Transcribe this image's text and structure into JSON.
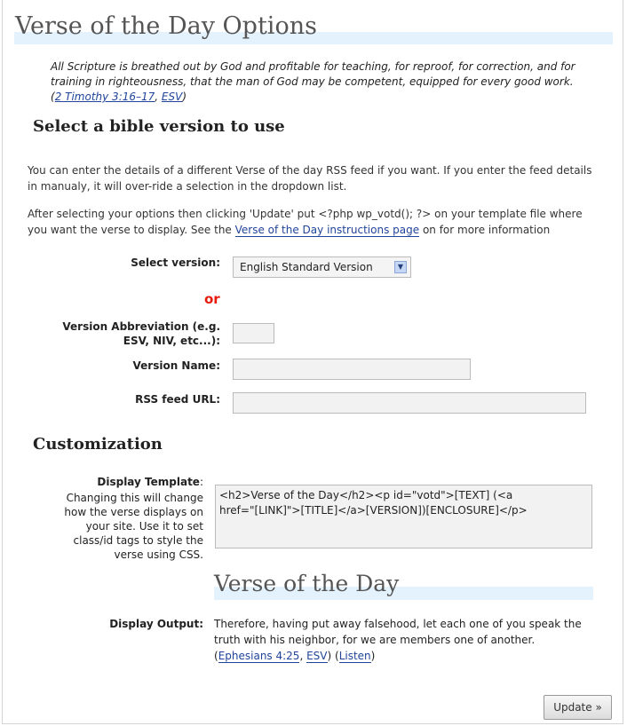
{
  "page": {
    "title": "Verse of the Day Options"
  },
  "quote": {
    "text": "All Scripture is breathed out by God and profitable for teaching, for reproof, for correction, and for training in righteousness, that the man of God may be competent, equipped for every good work.",
    "ref_open": " (",
    "ref_link": "2 Timothy 3:16–17",
    "ref_sep": ", ",
    "ref_version": "ESV",
    "ref_close": ")"
  },
  "section_version": {
    "heading": "Select a bible version to use",
    "para1": "You can enter the details of a different Verse of the day RSS feed if you want. If you enter the feed details in manualy, it will over-ride a selection in the dropdown list.",
    "para2_before": "After selecting your options then clicking 'Update' put <?php wp_votd(); ?> on your template file where you want the verse to display. See the ",
    "para2_link": "Verse of the Day instructions page",
    "para2_after": " on for more information"
  },
  "form": {
    "select_label": "Select version:",
    "select_value": "English Standard Version",
    "or_text": "or",
    "abbr_label_line1": "Version Abbreviation (e.g.",
    "abbr_label_line2": "ESV, NIV, etc...):",
    "abbr_value": "",
    "name_label": "Version Name:",
    "name_value": "",
    "rss_label": "RSS feed URL:",
    "rss_value": ""
  },
  "section_custom": {
    "heading": "Customization",
    "template_label": "Display Template",
    "template_colon": ":",
    "template_help": "Changing this will change how the verse displays on your site. Use it to set class/id tags to style the verse using CSS.",
    "template_value_line1": "<h2>Verse of the Day</h2><p id=\"votd\">[TEXT] (<a",
    "template_value_line2": "href=\"[LINK]\">[TITLE]</a>[VERSION])[ENCLOSURE]</p>",
    "preview_heading": "Verse of the Day",
    "output_label": "Display Output:",
    "output_text": "Therefore, having put away falsehood, let each one of you speak the truth with his neighbor, for we are members one of another.",
    "output_open": " (",
    "output_ref": "Ephesians 4:25",
    "output_sep": ", ",
    "output_version": "ESV",
    "output_mid": ") (",
    "output_listen": "Listen",
    "output_close": ")"
  },
  "buttons": {
    "update": "Update »"
  },
  "colors": {
    "link": "#21449a",
    "or": "#e81a0e",
    "heading_bar": "#e4f2fd"
  }
}
